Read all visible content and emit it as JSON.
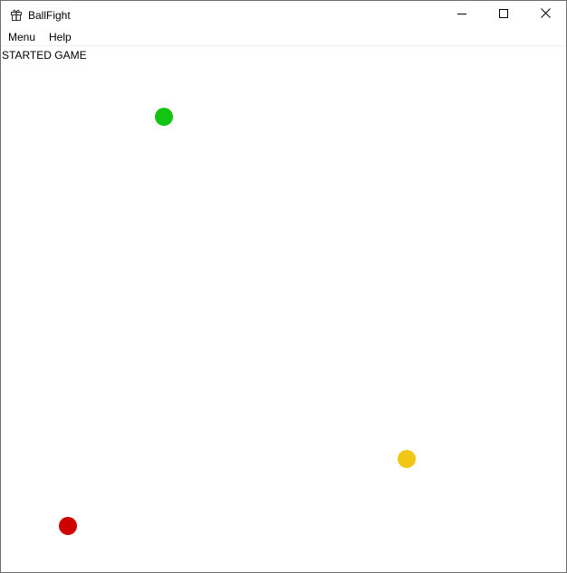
{
  "window": {
    "title": "BallFight",
    "app_icon": "gift-box-icon",
    "controls": {
      "minimize": "minimize-icon",
      "maximize": "maximize-icon",
      "close": "close-icon"
    }
  },
  "menubar": {
    "items": [
      {
        "label": "Menu"
      },
      {
        "label": "Help"
      }
    ]
  },
  "game": {
    "status": "STARTED GAME",
    "balls": [
      {
        "color_name": "green",
        "color": "#12c512"
      },
      {
        "color_name": "yellow",
        "color": "#f0c814"
      },
      {
        "color_name": "red",
        "color": "#cf0000"
      }
    ]
  }
}
